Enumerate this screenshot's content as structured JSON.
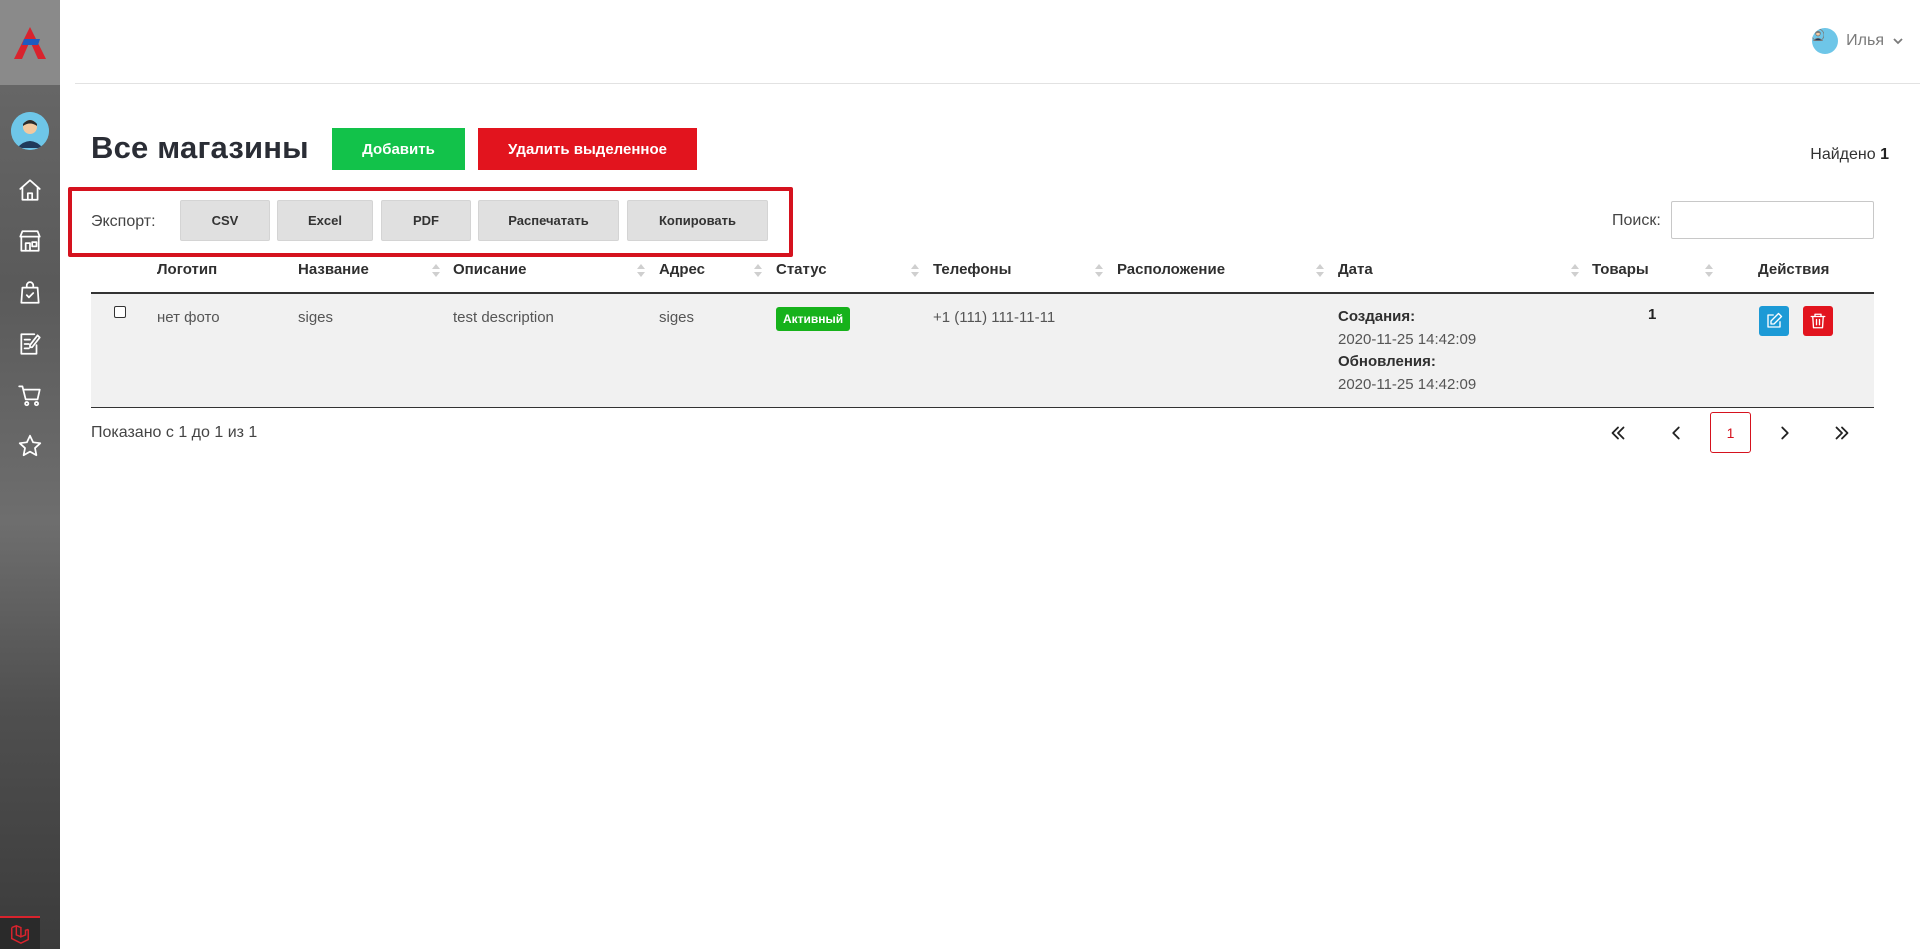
{
  "header": {
    "user_name": "Илья"
  },
  "page": {
    "title": "Все магазины",
    "add_label": "Добавить",
    "delete_selected_label": "Удалить выделенное",
    "found_label": "Найдено",
    "found_count": "1"
  },
  "export": {
    "label": "Экспорт:",
    "buttons": [
      "CSV",
      "Excel",
      "PDF",
      "Распечатать",
      "Копировать"
    ]
  },
  "search": {
    "label": "Поиск:",
    "value": ""
  },
  "table": {
    "columns": [
      "Логотип",
      "Название",
      "Описание",
      "Адрес",
      "Статус",
      "Телефоны",
      "Расположение",
      "Дата",
      "Товары",
      "Действия"
    ],
    "rows": [
      {
        "logo": "нет фото",
        "name": "siges",
        "description": "test description",
        "address": "siges",
        "status": "Активный",
        "phones": "+1 (111) 111-11-11",
        "location": "",
        "created_label": "Создания:",
        "created": "2020-11-25 14:42:09",
        "updated_label": "Обновления:",
        "updated": "2020-11-25 14:42:09",
        "products": "1"
      }
    ]
  },
  "footer": {
    "info": "Показано с 1 до 1 из 1",
    "current_page": "1"
  },
  "colors": {
    "brand_red": "#e2141e",
    "add_green": "#12c24a",
    "status_green": "#16b21b",
    "edit_blue": "#1c9ad6"
  },
  "icons": {
    "sidebar": [
      "home-icon",
      "store-icon",
      "shopping-bag-icon",
      "edit-document-icon",
      "cart-icon",
      "star-icon"
    ],
    "pagination": [
      "double-chevron-left-icon",
      "chevron-left-icon",
      "chevron-right-icon",
      "double-chevron-right-icon"
    ],
    "actions": [
      "edit-icon",
      "trash-icon"
    ]
  }
}
